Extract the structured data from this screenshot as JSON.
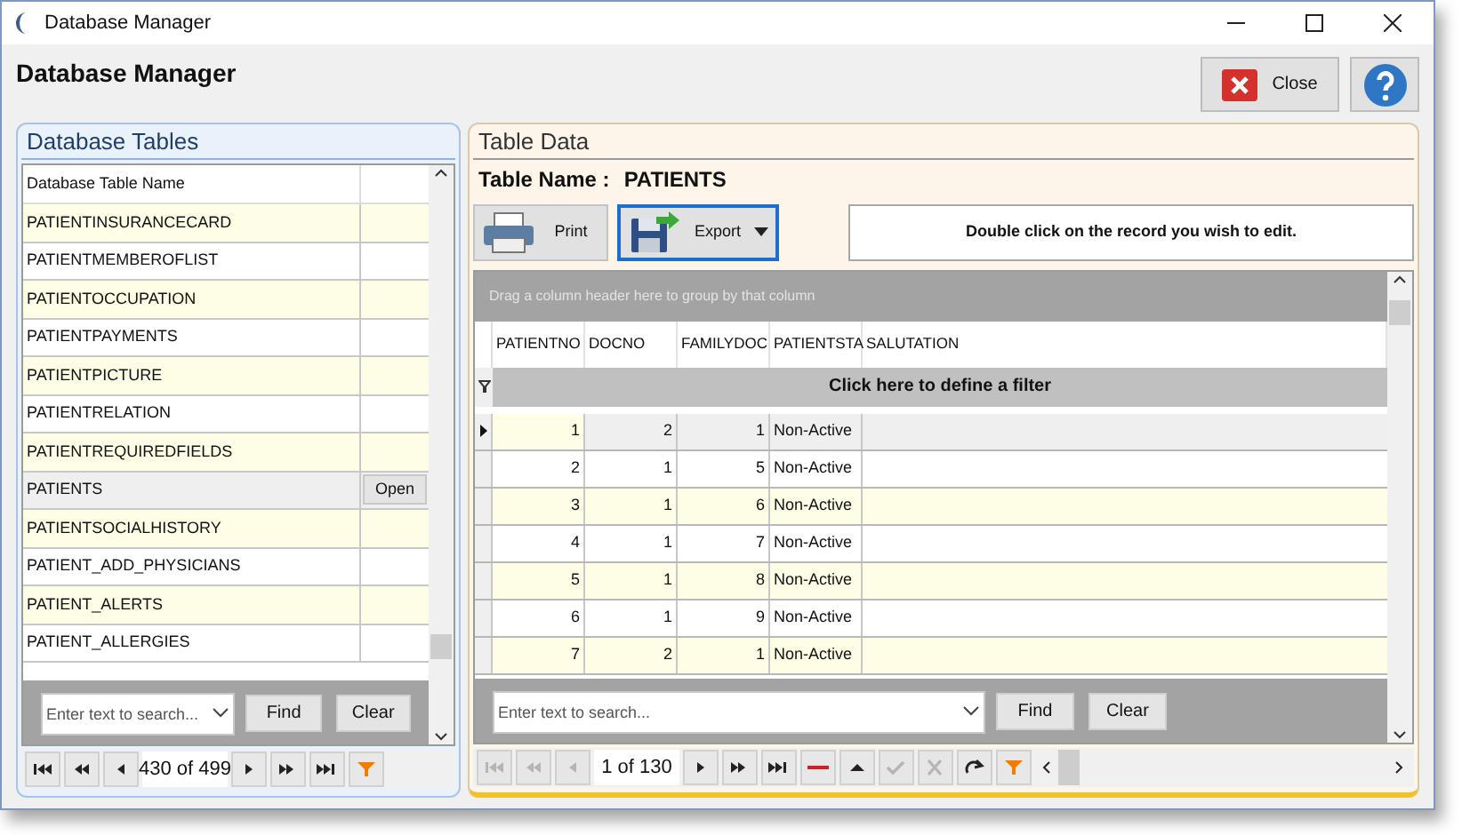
{
  "window": {
    "title": "Database Manager"
  },
  "header": {
    "title": "Database Manager",
    "close_button": "Close"
  },
  "tables_panel": {
    "title": "Database Tables",
    "column_1": "Database Table Name",
    "rows": [
      {
        "name": "PATIENTINSURANCECARD",
        "selected": false
      },
      {
        "name": "PATIENTMEMBEROFLIST",
        "selected": false
      },
      {
        "name": "PATIENTOCCUPATION",
        "selected": false
      },
      {
        "name": "PATIENTPAYMENTS",
        "selected": false
      },
      {
        "name": "PATIENTPICTURE",
        "selected": false
      },
      {
        "name": "PATIENTRELATION",
        "selected": false
      },
      {
        "name": "PATIENTREQUIREDFIELDS",
        "selected": false
      },
      {
        "name": "PATIENTS",
        "selected": true,
        "button": "Open"
      },
      {
        "name": "PATIENTSOCIALHISTORY",
        "selected": false
      },
      {
        "name": "PATIENT_ADD_PHYSICIANS",
        "selected": false
      },
      {
        "name": "PATIENT_ALERTS",
        "selected": false
      },
      {
        "name": "PATIENT_ALLERGIES",
        "selected": false
      }
    ],
    "search": {
      "placeholder": "Enter text to search...",
      "find": "Find",
      "clear": "Clear"
    },
    "navigator": {
      "position": "430 of 499",
      "buttons": [
        {
          "kind": "first",
          "disabled": false
        },
        {
          "kind": "prev_page",
          "disabled": false
        },
        {
          "kind": "prev",
          "disabled": false
        },
        {
          "kind": "position"
        },
        {
          "kind": "next",
          "disabled": false
        },
        {
          "kind": "next_page",
          "disabled": false
        },
        {
          "kind": "last",
          "disabled": false
        },
        {
          "kind": "filter",
          "disabled": false
        }
      ]
    }
  },
  "data_panel": {
    "title": "Table Data",
    "table_name_label": "Table Name :",
    "table_name": "PATIENTS",
    "buttons": [
      {
        "kind": "print",
        "label": "Print",
        "selected": false
      },
      {
        "kind": "export",
        "label": "Export",
        "selected": true
      }
    ],
    "hint": "Double click on the record you wish to edit.",
    "group_panel": "Drag a column header here to group by that column",
    "columns": [
      "PATIENTNO",
      "DOCNO",
      "FAMILYDOC",
      "PATIENTSTA",
      "SALUTATION"
    ],
    "filter_row": "Click here to define a filter",
    "rows": [
      {
        "cells": [
          "1",
          "2",
          "1",
          "Non-Active"
        ],
        "selected": true
      },
      {
        "cells": [
          "2",
          "1",
          "5",
          "Non-Active"
        ],
        "selected": false
      },
      {
        "cells": [
          "3",
          "1",
          "6",
          "Non-Active"
        ],
        "selected": false
      },
      {
        "cells": [
          "4",
          "1",
          "7",
          "Non-Active"
        ],
        "selected": false
      },
      {
        "cells": [
          "5",
          "1",
          "8",
          "Non-Active"
        ],
        "selected": false
      },
      {
        "cells": [
          "6",
          "1",
          "9",
          "Non-Active"
        ],
        "selected": false
      },
      {
        "cells": [
          "7",
          "2",
          "1",
          "Non-Active"
        ],
        "selected": false
      }
    ],
    "search": {
      "placeholder": "Enter text to search...",
      "find": "Find",
      "clear": "Clear"
    },
    "navigator": {
      "position": "1 of 130",
      "buttons": [
        {
          "kind": "first",
          "disabled": true
        },
        {
          "kind": "prev_page",
          "disabled": true
        },
        {
          "kind": "prev",
          "disabled": true
        },
        {
          "kind": "position"
        },
        {
          "kind": "next",
          "disabled": false
        },
        {
          "kind": "next_page",
          "disabled": false
        },
        {
          "kind": "last",
          "disabled": false
        },
        {
          "kind": "delete",
          "disabled": false
        },
        {
          "kind": "up",
          "disabled": false
        },
        {
          "kind": "post",
          "disabled": true
        },
        {
          "kind": "cancel",
          "disabled": true
        },
        {
          "kind": "refresh",
          "disabled": false
        },
        {
          "kind": "filter",
          "disabled": false
        }
      ]
    }
  }
}
